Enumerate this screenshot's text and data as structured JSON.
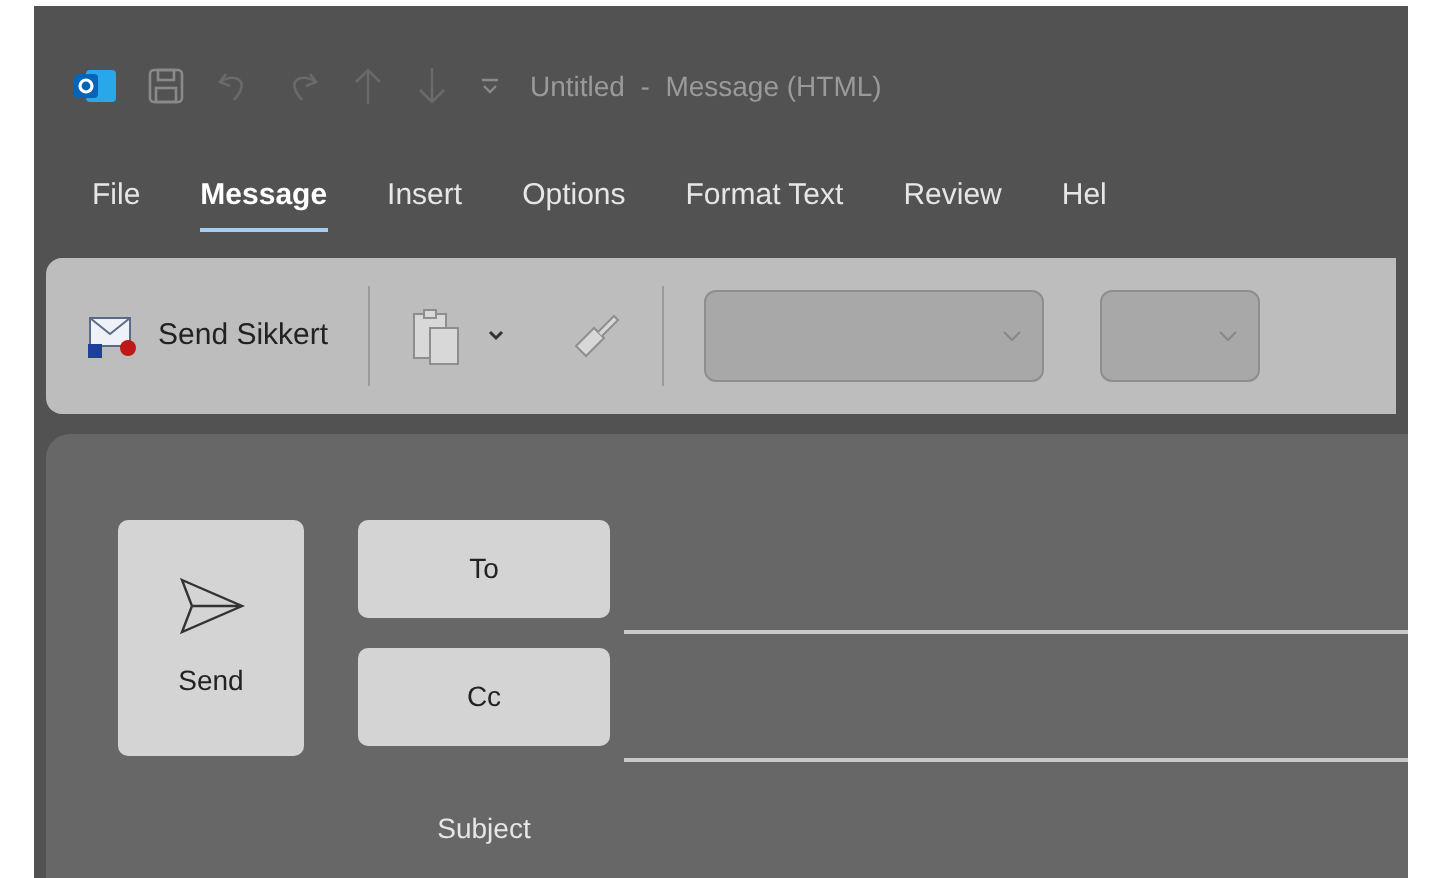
{
  "window": {
    "title": "Untitled  -  Message (HTML)"
  },
  "tabs": [
    {
      "label": "File",
      "selected": false
    },
    {
      "label": "Message",
      "selected": true
    },
    {
      "label": "Insert",
      "selected": false
    },
    {
      "label": "Options",
      "selected": false
    },
    {
      "label": "Format Text",
      "selected": false
    },
    {
      "label": "Review",
      "selected": false
    },
    {
      "label": "Hel",
      "selected": false
    }
  ],
  "ribbon": {
    "send_secure": "Send Sikkert"
  },
  "compose": {
    "send": "Send",
    "to": "To",
    "cc": "Cc",
    "subject": "Subject"
  }
}
